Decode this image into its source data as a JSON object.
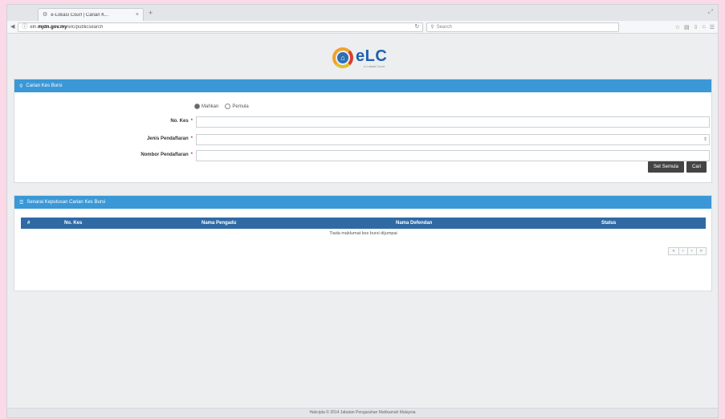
{
  "browser": {
    "tab_title": "e-Lokasi Courl | Carian K...",
    "tab_close": "×",
    "new_tab": "+",
    "url_host": "mjdn.gov.my",
    "url_prefix": "eln.",
    "url_path": "/elc/publicsearch",
    "reload": "↻",
    "search_placeholder": "Search"
  },
  "logo": {
    "text": "eLC",
    "subtitle": "e-Lokasi Court"
  },
  "form_panel": {
    "title": "Carian Kes Bursi",
    "radio_options": [
      "Mahkan",
      "Pemula"
    ],
    "fields": [
      {
        "label": "No. Kes"
      },
      {
        "label": "Jenis Pendaftaran"
      },
      {
        "label": "Nombor Pendaftaran"
      }
    ],
    "required_mark": "*",
    "reset_button": "Set Semula",
    "search_button": "Cari"
  },
  "results_panel": {
    "title": "Senarai Keputusan Carian Kes Bursi",
    "columns": [
      "#",
      "No. Kes",
      "Nama Pengadu",
      "Nama Defendan",
      "Status"
    ],
    "empty_message": "Tiada maklumat kes bursi dijumpai",
    "pager": [
      "«",
      "‹",
      "›",
      "»"
    ]
  },
  "footer": {
    "text": "Hakcipta © 2014 Jabatan Pengarahan Mahkamah Malaysia"
  }
}
